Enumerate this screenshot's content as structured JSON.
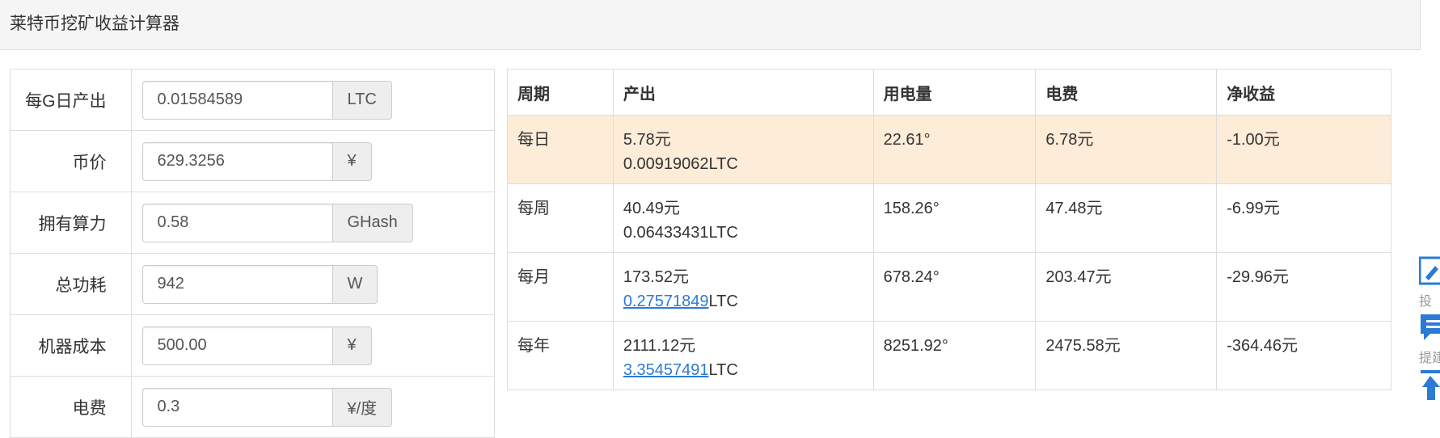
{
  "panel": {
    "title": "莱特币挖矿收益计算器"
  },
  "form": {
    "rows": [
      {
        "label": "每G日产出",
        "value": "0.01584589",
        "unit": "LTC"
      },
      {
        "label": "币价",
        "value": "629.3256",
        "unit": "¥"
      },
      {
        "label": "拥有算力",
        "value": "0.58",
        "unit": "GHash"
      },
      {
        "label": "总功耗",
        "value": "942",
        "unit": "W"
      },
      {
        "label": "机器成本",
        "value": "500.00",
        "unit": "¥"
      },
      {
        "label": "电费",
        "value": "0.3",
        "unit": "¥/度"
      }
    ]
  },
  "results": {
    "headers": [
      "周期",
      "产出",
      "用电量",
      "电费",
      "净收益"
    ],
    "rows": [
      {
        "period": "每日",
        "output_cny": "5.78元",
        "output_ltc": "0.00919062",
        "ltc_unit": "LTC",
        "power": "22.61°",
        "fee": "6.78元",
        "net": "-1.00元",
        "highlighted": true,
        "ltc_is_link": false
      },
      {
        "period": "每周",
        "output_cny": "40.49元",
        "output_ltc": "0.06433431",
        "ltc_unit": "LTC",
        "power": "158.26°",
        "fee": "47.48元",
        "net": "-6.99元",
        "highlighted": false,
        "ltc_is_link": false
      },
      {
        "period": "每月",
        "output_cny": "173.52元",
        "output_ltc": "0.27571849",
        "ltc_unit": "LTC",
        "power": "678.24°",
        "fee": "203.47元",
        "net": "-29.96元",
        "highlighted": false,
        "ltc_is_link": true
      },
      {
        "period": "每年",
        "output_cny": "2111.12元",
        "output_ltc": "3.35457491",
        "ltc_unit": "LTC",
        "power": "8251.92°",
        "fee": "2475.58元",
        "net": "-364.46元",
        "highlighted": false,
        "ltc_is_link": true
      }
    ]
  },
  "side_tools": {
    "items": [
      {
        "label": "投",
        "icon": "edit-icon"
      },
      {
        "label": "提建",
        "icon": "comment-icon"
      },
      {
        "label": "",
        "icon": "back-to-top-icon"
      }
    ]
  },
  "colors": {
    "accent": "#2b7bd6",
    "warning_row": "#fcecd8",
    "border": "#dddddd",
    "heading_bg": "#f5f5f5"
  }
}
